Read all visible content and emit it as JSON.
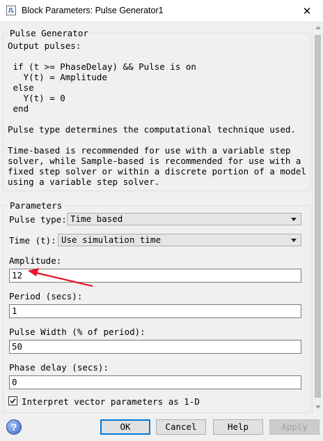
{
  "window": {
    "title": "Block Parameters: Pulse Generator1",
    "close_glyph": "✕"
  },
  "description": {
    "legend": "Pulse Generator",
    "text": "Output pulses:\n\n if (t >= PhaseDelay) && Pulse is on\n   Y(t) = Amplitude\n else\n   Y(t) = 0\n end\n\nPulse type determines the computational technique used.\n\nTime-based is recommended for use with a variable step\nsolver, while Sample-based is recommended for use with a\nfixed step solver or within a discrete portion of a model\nusing a variable step solver."
  },
  "parameters": {
    "legend": "Parameters",
    "pulse_type": {
      "label": "Pulse type:",
      "value": "Time based"
    },
    "time": {
      "label": "Time (t):",
      "value": "Use simulation time"
    },
    "amplitude": {
      "label": "Amplitude:",
      "value": "12"
    },
    "period": {
      "label": "Period (secs):",
      "value": "1"
    },
    "pulse_width": {
      "label": "Pulse Width (% of period):",
      "value": "50"
    },
    "phase_delay": {
      "label": "Phase delay (secs):",
      "value": "0"
    },
    "interpret_vector": {
      "label": "Interpret vector parameters as 1-D",
      "checked": true
    }
  },
  "buttons": {
    "help_icon": "?",
    "ok": "OK",
    "cancel": "Cancel",
    "help": "Help",
    "apply": "Apply"
  },
  "colors": {
    "annotation_arrow": "#e8132a",
    "default_button_border": "#0078d7",
    "help_icon": "#3a64c8"
  },
  "icons": [
    "simulink-block-icon",
    "close-icon",
    "dropdown-arrow-icon",
    "checkmark-icon",
    "help-icon"
  ]
}
